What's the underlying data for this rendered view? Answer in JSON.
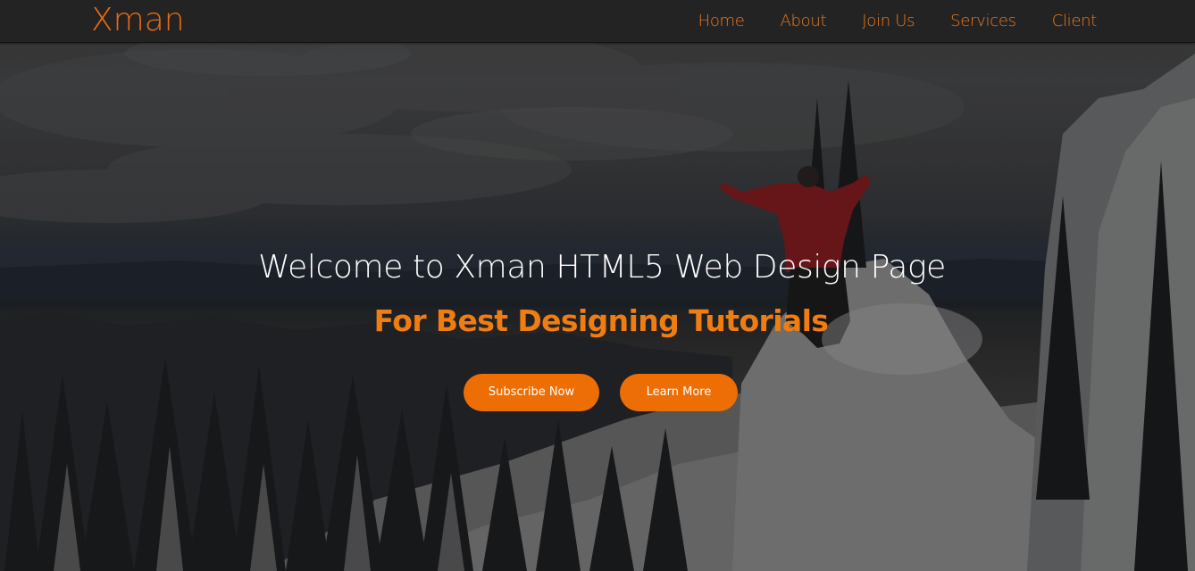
{
  "navbar": {
    "brand": "Xman",
    "links": [
      "Home",
      "About",
      "Join Us",
      "Services",
      "Client"
    ]
  },
  "hero": {
    "title": "Welcome to Xman HTML5 Web Design Page",
    "subtitle": "For Best Designing Tutorials",
    "buttons": {
      "subscribe": "Subscribe Now",
      "learn_more": "Learn More"
    }
  },
  "colors": {
    "accent": "#ee6e06",
    "navbar_bg": "#232323",
    "title_text": "#ffffff"
  }
}
